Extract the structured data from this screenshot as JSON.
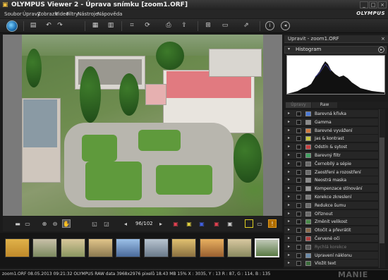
{
  "window": {
    "title": "OLYMPUS Viewer 2 -  Úprava snímku [zoom1.ORF]",
    "controls": [
      "_",
      "□",
      "×"
    ]
  },
  "menu": {
    "items": [
      "Soubor",
      "Úpravy",
      "Zobrazit",
      "Video",
      "Filtry",
      "Nástroje",
      "Nápověda"
    ],
    "brand": "OLYMPUS"
  },
  "toolbar": {
    "icons": [
      "globe-icon",
      "save-icon",
      "undo-icon",
      "redo-icon",
      "compare-icon",
      "info-icon",
      "crop-icon",
      "rotate-icon",
      "print-icon",
      "export-icon",
      "resize-icon",
      "share-icon",
      "help-icon",
      "minimize-panel-icon"
    ]
  },
  "controls": {
    "page_counter": "96/102"
  },
  "panel": {
    "title": "Upravit - zoom1.ORF",
    "histogram_label": "Histogram",
    "tabs": [
      "Úpravy",
      "Raw"
    ],
    "active_tab": "Úpravy",
    "adjustments": [
      {
        "label": "Barevná křivka",
        "dim": false
      },
      {
        "label": "Gamma",
        "dim": false
      },
      {
        "label": "Barevné vyvážení",
        "dim": false
      },
      {
        "label": "Jas & kontrast",
        "dim": false
      },
      {
        "label": "Odstín & sytost",
        "dim": false
      },
      {
        "label": "Barevný filtr",
        "dim": false
      },
      {
        "label": "Černobílý a sépie",
        "dim": false
      },
      {
        "label": "Zaostření a rozostření",
        "dim": false
      },
      {
        "label": "Neostrá maska",
        "dim": false
      },
      {
        "label": "Kompenzace stínování",
        "dim": false
      },
      {
        "label": "Korekce zkreslení",
        "dim": false
      },
      {
        "label": "Redukce šumu",
        "dim": false
      },
      {
        "label": "Oříznout",
        "dim": false
      },
      {
        "label": "Změnit velikost",
        "dim": false
      },
      {
        "label": "Otočit a převrátit",
        "dim": false
      },
      {
        "label": "Červené oči",
        "dim": false
      },
      {
        "label": "Rychlá korekce",
        "dim": true
      },
      {
        "label": "Upravení náklonu",
        "dim": false
      },
      {
        "label": "Vložit text",
        "dim": false
      }
    ]
  },
  "status": {
    "text": "zoom1.ORF  08.05.2013 09:21:32  OLYMPUS RAW data  3968x2976 pixelů  18.43 MB  15%  X : 3035, Y : 13  R : 87, G : 114, B : 135",
    "watermark": "MANIE"
  },
  "colors": {
    "accent_selected": "#e8e8e8",
    "panel_bg": "#262626"
  }
}
